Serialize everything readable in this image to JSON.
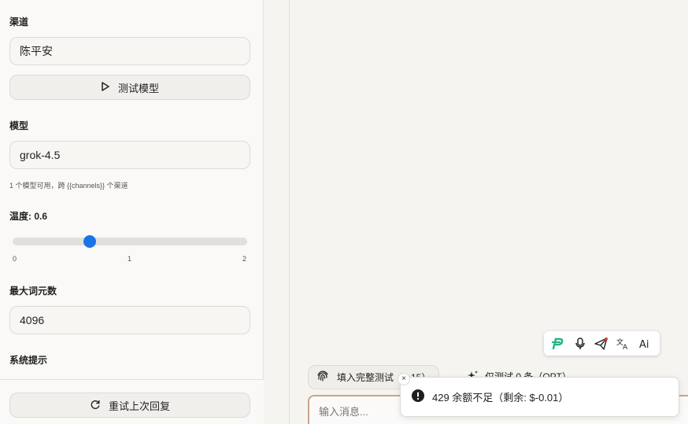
{
  "sidebar": {
    "channel_label": "渠道",
    "channel_value": "陈平安",
    "test_button": "测试模型",
    "model_label": "模型",
    "model_value": "grok-4.5",
    "model_hint": "1 个模型可用，跨 {{channels}} 个渠道",
    "temperature_label": "温度: 0.6",
    "temperature": {
      "min": 0,
      "max": 2,
      "value": 0.6,
      "ticks": [
        "0",
        "1",
        "2"
      ]
    },
    "max_tokens_label": "最大词元数",
    "max_tokens_value": "4096",
    "system_prompt_label": "系统提示",
    "retry_button": "重试上次回复"
  },
  "main": {
    "fill_chip": "填入完整测试（1.15）",
    "chip2": "仅测试 0 条（OPT）",
    "composer_placeholder": "输入消息...",
    "toolbar_icons": [
      "p-logo-icon",
      "mic-icon",
      "send-plane-icon",
      "translate-icon",
      "ai-text-icon"
    ]
  },
  "toast": {
    "message": "429 余额不足（剩余: $-0.01）",
    "close": "×"
  },
  "colors": {
    "accent": "#1a73e8",
    "composer_border": "#c9a58a",
    "brand_green": "#1fb584"
  }
}
